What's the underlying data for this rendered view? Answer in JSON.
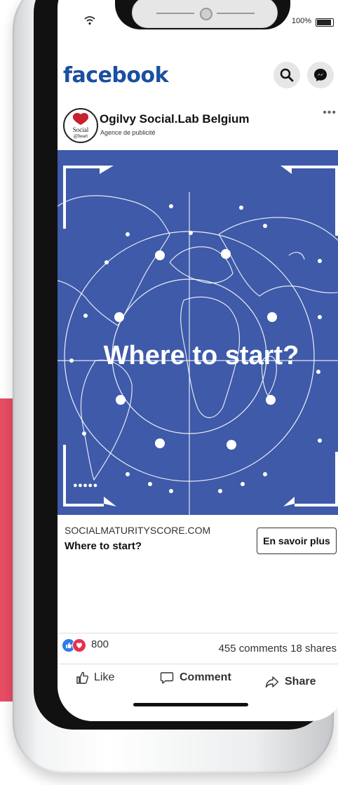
{
  "status_bar": {
    "battery_label": "100%",
    "icons": [
      "wifi-icon",
      "battery-icon"
    ]
  },
  "app": {
    "logo_text": "facebook",
    "header_icons": [
      "search-icon",
      "messenger-icon"
    ]
  },
  "post": {
    "page_name": "Ogilvy Social.Lab Belgium",
    "page_category": "Agence de publicité",
    "avatar_text": "Social@heart",
    "more_label": "•••",
    "image_headline": "Where to start?",
    "carousel_dots": "●●●●●"
  },
  "link_preview": {
    "domain": "SOCIALMATURITYSCORE.COM",
    "title": "Where to start?",
    "cta_label": "En savoir plus"
  },
  "engagement": {
    "reaction_count": "800",
    "comments_shares": "455 comments  18 shares",
    "reaction_types": [
      "like-reaction",
      "love-reaction"
    ]
  },
  "actions": {
    "like": "Like",
    "comment": "Comment",
    "share": "Share"
  },
  "colors": {
    "brand_blue": "#1b4fa0",
    "ad_background": "#3e5aa9",
    "accent_pink": "#e84d63",
    "like_blue": "#2f7be8",
    "love_red": "#e8304b"
  }
}
